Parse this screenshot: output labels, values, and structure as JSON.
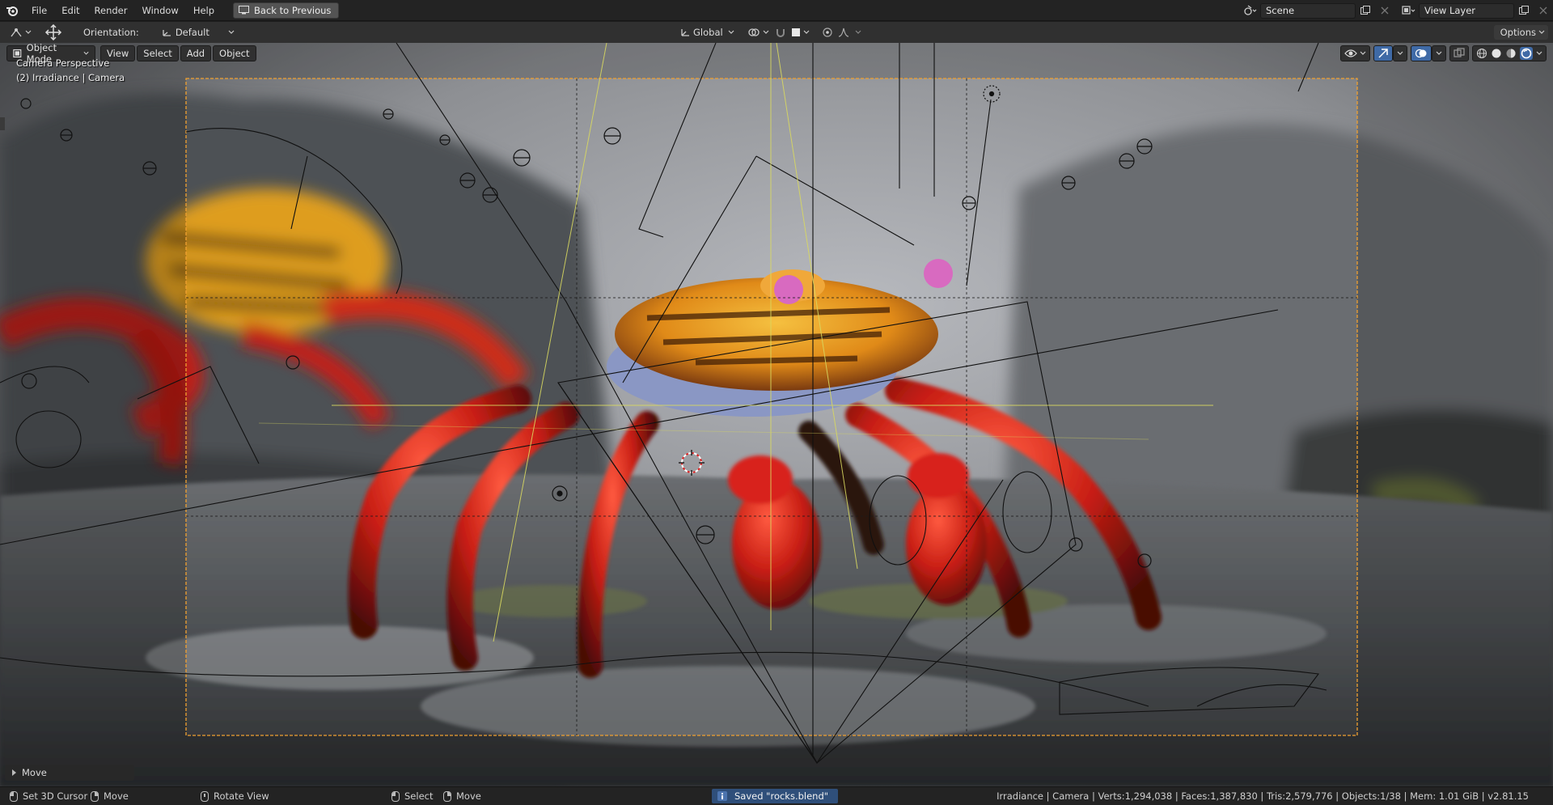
{
  "menu": {
    "items": [
      "File",
      "Edit",
      "Render",
      "Window",
      "Help"
    ],
    "back_label": "Back to Previous"
  },
  "top_right": {
    "scene": "Scene",
    "view_layer": "View Layer"
  },
  "toolbar": {
    "orientation_label": "Orientation:",
    "orientation_value": "Default",
    "transform_space": "Global",
    "options_label": "Options"
  },
  "viewport_header": {
    "mode": "Object Mode",
    "menus": [
      "View",
      "Select",
      "Add",
      "Object"
    ]
  },
  "viewport": {
    "perspective": "Camera Perspective",
    "object_info": "(2) Irradiance | Camera",
    "last_operator": "Move"
  },
  "statusbar": {
    "left_items": [
      {
        "icon": "left",
        "label": "Set 3D Cursor"
      },
      {
        "icon": "right",
        "label": "Move"
      },
      {
        "icon": "mid",
        "label": "Rotate View"
      },
      {
        "icon": "left",
        "label": "Select"
      },
      {
        "icon": "right",
        "label": "Move"
      }
    ],
    "saved_message": "Saved \"rocks.blend\"",
    "stats": "Irradiance | Camera | Verts:1,294,038 | Faces:1,387,830 | Tris:2,579,776 | Objects:1/38 | Mem: 1.01 GiB | v2.81.15"
  },
  "colors": {
    "camera_frame": "#f0a030",
    "selection_yellow": "#d8d860",
    "status_highlight": "#2f4f7a"
  }
}
